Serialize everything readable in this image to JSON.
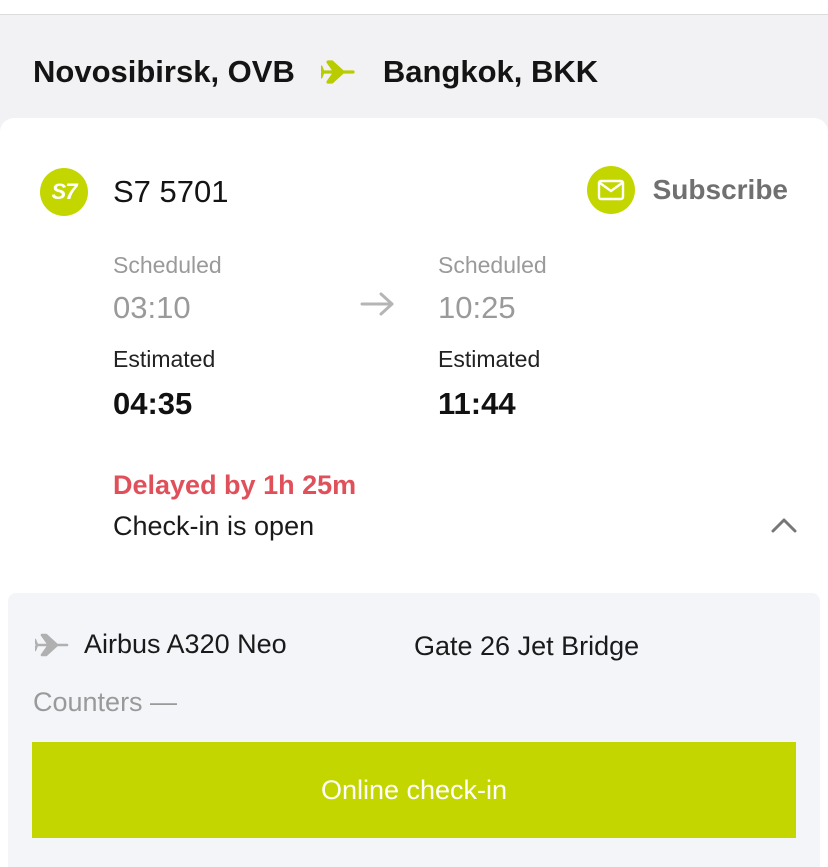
{
  "route": {
    "origin": "Novosibirsk, OVB",
    "destination": "Bangkok, BKK",
    "separator_icon": "plane-icon"
  },
  "flight": {
    "airline_logo_text": "S7",
    "number": "S7 5701",
    "subscribe_label": "Subscribe",
    "subscribe_icon": "mail-icon"
  },
  "departure": {
    "scheduled_label": "Scheduled",
    "scheduled_time": "03:10",
    "estimated_label": "Estimated",
    "estimated_time": "04:35"
  },
  "arrival": {
    "scheduled_label": "Scheduled",
    "scheduled_time": "10:25",
    "estimated_label": "Estimated",
    "estimated_time": "11:44"
  },
  "status": {
    "delay": "Delayed by 1h 25m",
    "checkin": "Check-in is open"
  },
  "details": {
    "aircraft": "Airbus A320 Neo",
    "gate": "Gate 26 Jet Bridge",
    "counters": "Counters —",
    "checkin_button": "Online check-in"
  },
  "colors": {
    "accent": "#c4d600",
    "delay": "#e0505a",
    "muted": "#9a9a9a"
  }
}
